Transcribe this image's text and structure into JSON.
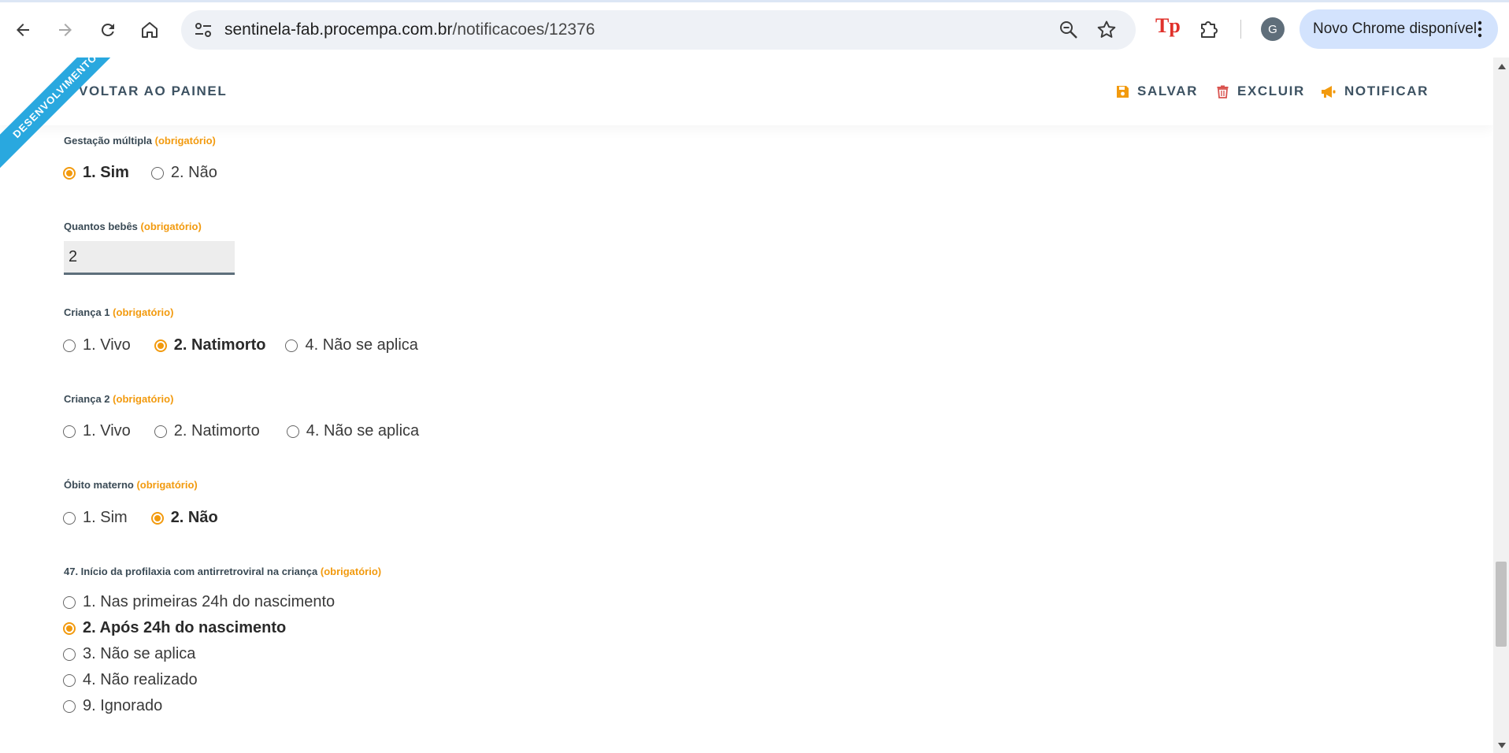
{
  "browser": {
    "url_host": "sentinela-fab.procempa.com.br",
    "url_path": "/notificacoes/12376",
    "profile_initial": "G",
    "update_chip_label": "Novo Chrome disponível",
    "extension_label": "Tp",
    "accent_color": "#d3e3fd"
  },
  "header": {
    "ribbon_text": "DESENVOLVIMENTO",
    "back_label": "VOLTAR AO PAINEL",
    "save_label": "SALVAR",
    "delete_label": "EXCLUIR",
    "notify_label": "NOTIFICAR",
    "accent_color": "#f29a0e",
    "delete_color": "#d9534f"
  },
  "form": {
    "required_tag": "(obrigatório)",
    "multiple_pregnancy": {
      "label": "Gestação múltipla",
      "options": [
        "1. Sim",
        "2. Não"
      ],
      "selected": "1. Sim"
    },
    "babies_count": {
      "label": "Quantos bebês",
      "value": "2"
    },
    "child1": {
      "label": "Criança 1",
      "options": [
        "1. Vivo",
        "2. Natimorto",
        "4. Não se aplica"
      ],
      "selected": "2. Natimorto"
    },
    "child2": {
      "label": "Criança 2",
      "options": [
        "1. Vivo",
        "2. Natimorto",
        "4. Não se aplica"
      ],
      "selected": null
    },
    "maternal_death": {
      "label": "Óbito materno",
      "options": [
        "1. Sim",
        "2. Não"
      ],
      "selected": "2. Não"
    },
    "prophylaxis": {
      "label": "47. Início da profilaxia com antirretroviral na criança",
      "options": [
        "1. Nas primeiras 24h do nascimento",
        "2. Após 24h do nascimento",
        "3. Não se aplica",
        "4. Não realizado",
        "9. Ignorado"
      ],
      "selected": "2. Após 24h do nascimento"
    }
  }
}
